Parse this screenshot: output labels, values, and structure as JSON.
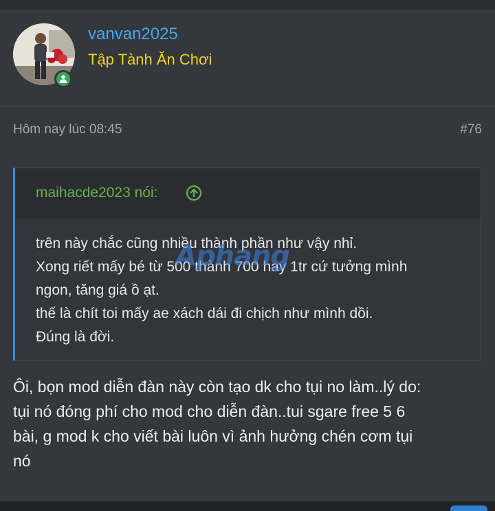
{
  "user": {
    "name": "vanvan2025",
    "title": "Tập Tành Ăn Chơi"
  },
  "post": {
    "date": "Hôm nay lúc 08:45",
    "number": "#76"
  },
  "quote": {
    "author": "maihacde2023 nói:",
    "lines": [
      "trên này chắc cũng nhiều thành phần như vậy nhỉ.",
      "Xong riết mấy bé từ 500 thành 700 hay 1tr cứ tưởng mình",
      "ngon, tăng giá ồ ạt.",
      "thế là chít toi mấy ae xách dái đi chịch như mình dồi.",
      "Đúng là đời."
    ]
  },
  "watermark": "Aphang",
  "message": {
    "lines": [
      "Ôi, bọn mod diễn đàn này còn tạo dk cho tụi no làm..lý do:",
      "tụi nó đóng phí cho mod cho diễn đàn..tui sgare free 5 6",
      "bài, g mod k cho viết bài luôn vì ảnh hưởng chén cơm tụi",
      "nó"
    ]
  },
  "colors": {
    "background": "#34373c",
    "username": "#47a7eb",
    "user_title": "#f2d31a",
    "quote_author": "#6ab04c",
    "online": "#3ba55c"
  }
}
